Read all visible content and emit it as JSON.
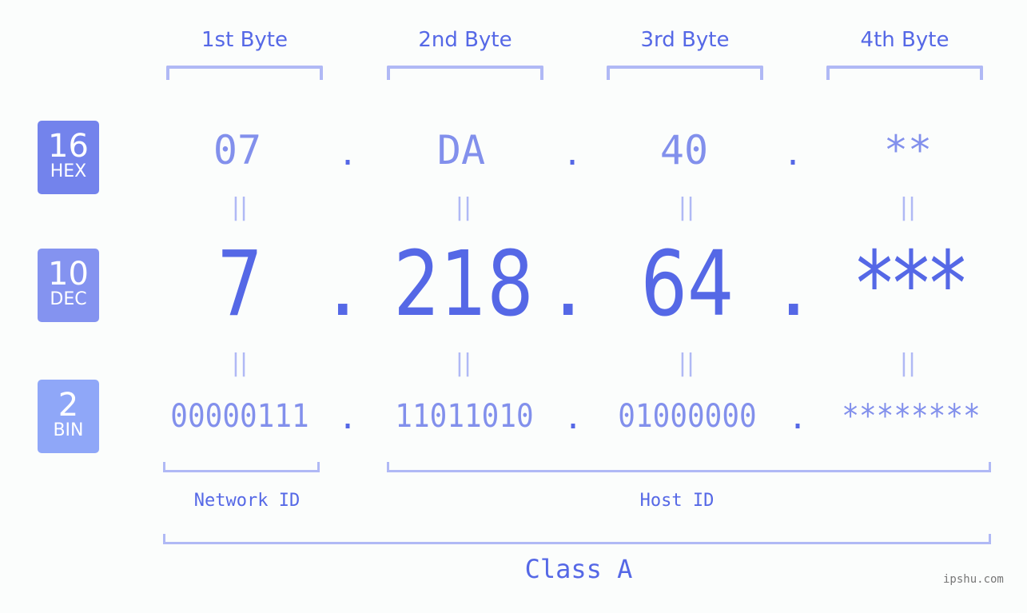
{
  "badges": [
    {
      "num": "16",
      "label": "HEX",
      "color": "#7383ec"
    },
    {
      "num": "10",
      "label": "DEC",
      "color": "#8493f0"
    },
    {
      "num": "2",
      "label": "BIN",
      "color": "#8fa7f8"
    }
  ],
  "byte_headers": [
    "1st Byte",
    "2nd Byte",
    "3rd Byte",
    "4th Byte"
  ],
  "hex": [
    "07",
    "DA",
    "40",
    "**"
  ],
  "dec": [
    "7",
    "218",
    "64",
    "***"
  ],
  "bin": [
    "00000111",
    "11011010",
    "01000000",
    "********"
  ],
  "separator": ".",
  "equals": "||",
  "network_id_label": "Network ID",
  "host_id_label": "Host ID",
  "class_label": "Class A",
  "watermark": "ipshu.com",
  "colors": {
    "accent": "#5568e6",
    "light_accent": "#8290ec",
    "bracket": "#b0b9f5",
    "background": "#fbfdfc"
  }
}
